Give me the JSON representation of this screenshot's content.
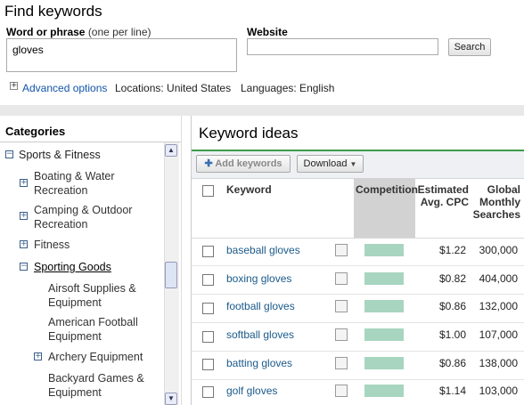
{
  "find": {
    "title": "Find keywords",
    "word_label": "Word or phrase",
    "word_hint": "(one per line)",
    "word_value": "gloves",
    "website_label": "Website",
    "website_value": "",
    "search_button": "Search",
    "advanced_link": "Advanced options",
    "locations": "Locations: United States",
    "languages": "Languages: English"
  },
  "categories": {
    "title": "Categories",
    "items": [
      {
        "label": "Sports & Fitness",
        "toggle": "minus"
      },
      {
        "label": "Boating & Water Recreation",
        "toggle": "plus"
      },
      {
        "label": "Camping & Outdoor Recreation",
        "toggle": "plus"
      },
      {
        "label": "Fitness",
        "toggle": "plus"
      },
      {
        "label": "Sporting Goods",
        "toggle": "minus",
        "selected": true
      },
      {
        "label": "Airsoft Supplies & Equipment",
        "toggle": "none"
      },
      {
        "label": "American Football Equipment",
        "toggle": "none"
      },
      {
        "label": "Archery Equipment",
        "toggle": "plus"
      },
      {
        "label": "Backyard Games & Equipment",
        "toggle": "none"
      }
    ]
  },
  "keyword_ideas": {
    "title": "Keyword ideas",
    "add_button": "Add keywords",
    "download_button": "Download",
    "columns": {
      "keyword": "Keyword",
      "competition": "Competition",
      "cpc": "Estimated Avg. CPC",
      "searches": "Global Monthly Searches"
    },
    "rows": [
      {
        "keyword": "baseball gloves",
        "cpc": "$1.22",
        "searches": "300,000"
      },
      {
        "keyword": "boxing gloves",
        "cpc": "$0.82",
        "searches": "404,000"
      },
      {
        "keyword": "football gloves",
        "cpc": "$0.86",
        "searches": "132,000"
      },
      {
        "keyword": "softball gloves",
        "cpc": "$1.00",
        "searches": "107,000"
      },
      {
        "keyword": "batting gloves",
        "cpc": "$0.86",
        "searches": "138,000"
      },
      {
        "keyword": "golf gloves",
        "cpc": "$1.14",
        "searches": "103,000"
      }
    ]
  },
  "colors": {
    "accent_green": "#3c9b4b",
    "competition_bar": "#a8d5c0",
    "link_blue": "#1a5a8a"
  }
}
